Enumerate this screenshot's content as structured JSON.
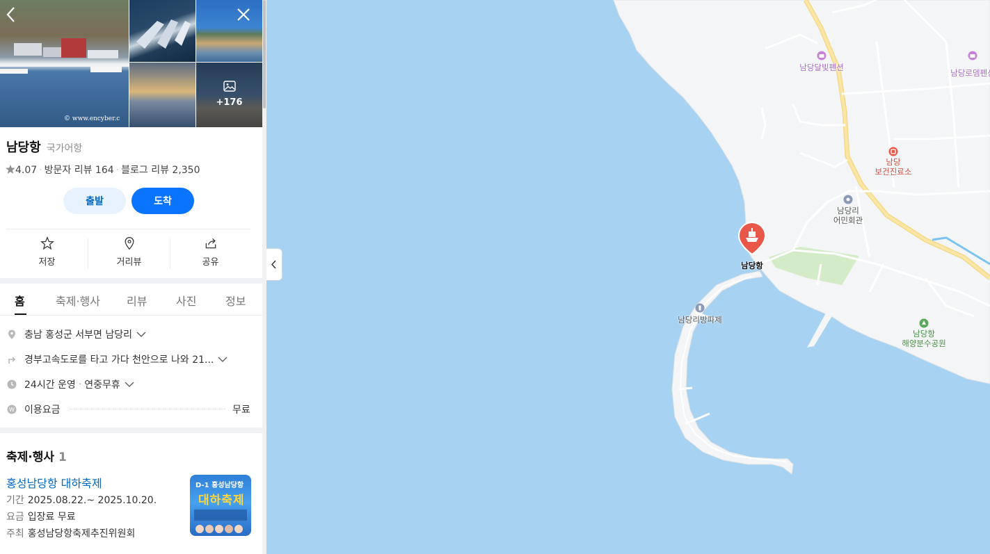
{
  "photos": {
    "more_count": "+176",
    "watermark": "© www.encyber.c"
  },
  "place": {
    "name": "남당항",
    "category": "국가어항",
    "rating": "4.07",
    "visitor_reviews": "방문자 리뷰 164",
    "blog_reviews": "블로그 리뷰 2,350"
  },
  "buttons": {
    "depart": "출발",
    "arrive": "도착"
  },
  "actions": {
    "save": "저장",
    "street_view": "거리뷰",
    "share": "공유"
  },
  "tabs": [
    "홈",
    "축제·행사",
    "리뷰",
    "사진",
    "정보"
  ],
  "info": {
    "address": "충남 홍성군 서부면 남당리",
    "directions": "경부고속도로를 타고 가다 천안으로 나와 21...",
    "hours": "24시간 운영",
    "closed": "연중무휴",
    "fee_label": "이용요금",
    "fee_value": "무료"
  },
  "festival": {
    "section_title": "축제·행사",
    "count": "1",
    "name": "홍성남당항 대하축제",
    "period_key": "기간",
    "period": "2025.08.22.~ 2025.10.20.",
    "fee_key": "요금",
    "fee": "입장료 무료",
    "host_key": "주최",
    "host": "홍성남당항축제추진위원회",
    "poster_badge": "D-1 홍성남당항",
    "poster_title": "대하축제"
  },
  "map": {
    "labels": {
      "pension1": "남당달빛펜션",
      "pension2": "남당로뎀펜션",
      "clinic": "남당\n보건진료소",
      "hall": "남당리\n어민회관",
      "port": "남당항",
      "breakwater": "남당리방파제",
      "park": "남당항\n해양분수공원"
    }
  },
  "colors": {
    "accent": "#0a74ff",
    "water": "#a7d2f1",
    "land": "#f4f5f6",
    "pin": "#e8574a"
  }
}
